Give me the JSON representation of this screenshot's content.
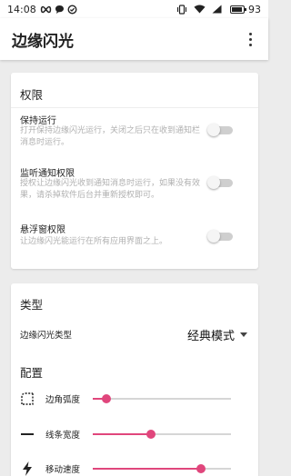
{
  "status_bar": {
    "time": "14:08",
    "battery": "93",
    "battery_level": 0.93,
    "icons": [
      "infinity-icon",
      "chat-bubble-icon",
      "check-circle-icon",
      "vibrate-icon",
      "wifi-icon",
      "signal-icon",
      "battery-icon"
    ]
  },
  "app_bar": {
    "title": "边缘闪光",
    "more_icon": "more-vert-icon"
  },
  "permissions": {
    "section_title": "权限",
    "items": [
      {
        "title": "保持运行",
        "desc": "打开保持边缘闪光运行，关闭之后只在收到通知栏消息时运行。",
        "enabled": false
      },
      {
        "title": "监听通知权限",
        "desc": "授权让边缘闪光收到通知消息时运行，如果没有效果，请杀掉软件后台并重新授权即可。",
        "enabled": false
      },
      {
        "title": "悬浮窗权限",
        "desc": "让边缘闪光能运行在所有应用界面之上。",
        "enabled": false
      }
    ]
  },
  "type_section": {
    "section_title": "类型",
    "label": "边缘闪光类型",
    "value": "经典模式"
  },
  "config_section": {
    "section_title": "配置",
    "sliders": [
      {
        "label": "边角弧度",
        "icon": "corner-icon",
        "value": 0.1
      },
      {
        "label": "线条宽度",
        "icon": "line-icon",
        "value": 0.42
      },
      {
        "label": "移动速度",
        "icon": "lightning-icon",
        "value": 0.78
      }
    ]
  },
  "colors": {
    "accent": "#e0467c",
    "background": "#ececec",
    "card": "#ffffff"
  }
}
